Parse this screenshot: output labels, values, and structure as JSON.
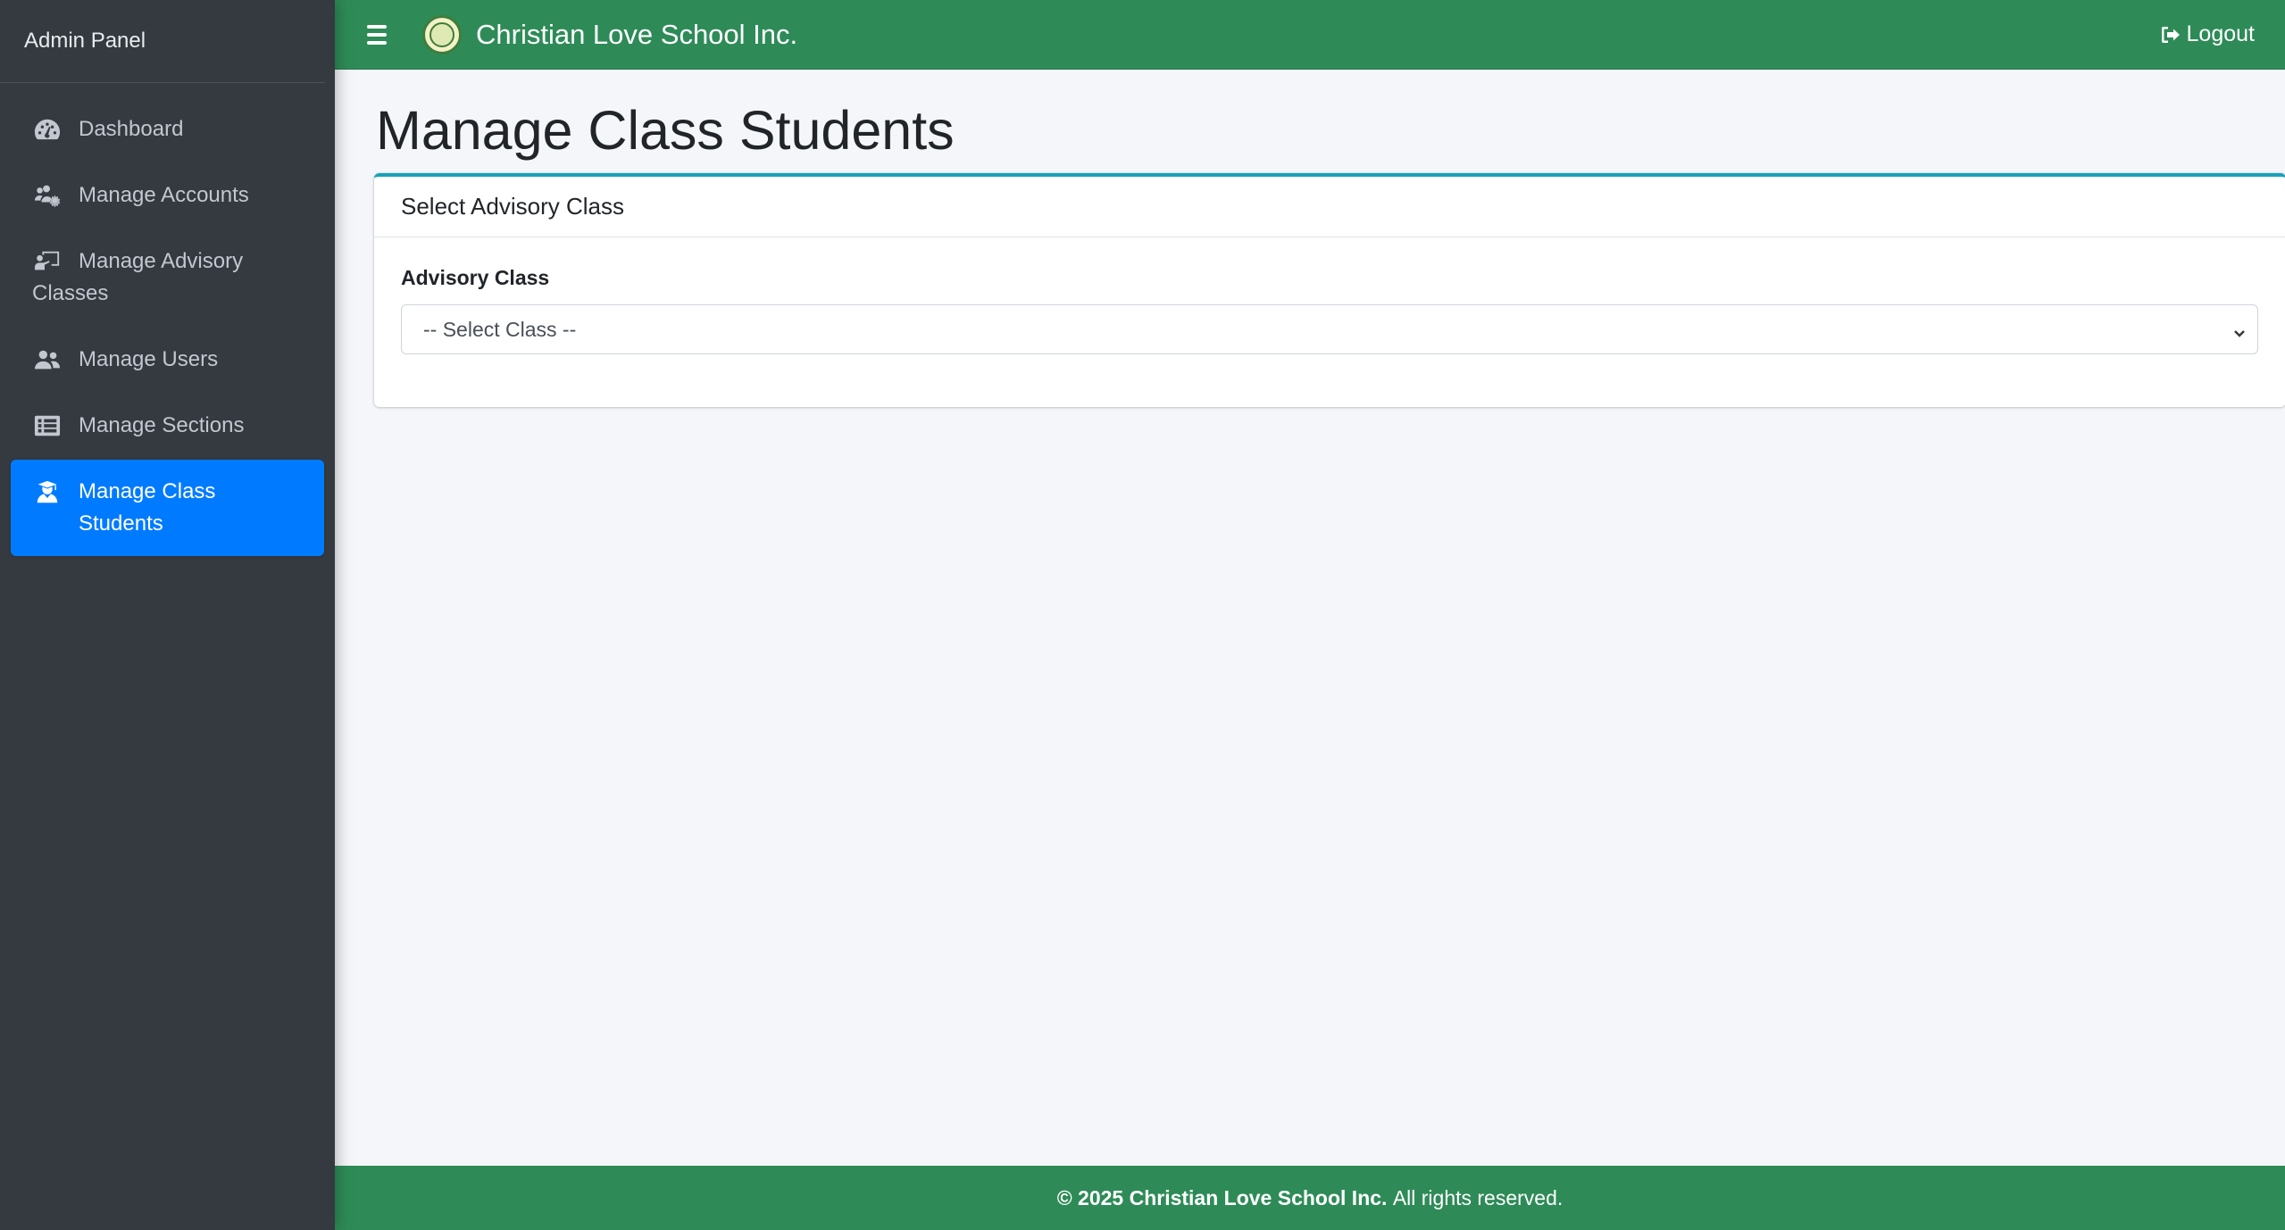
{
  "sidebar": {
    "brand": "Admin Panel",
    "items": [
      {
        "label": "Dashboard",
        "icon": "tachometer-icon"
      },
      {
        "label": "Manage Accounts",
        "icon": "users-cog-icon"
      },
      {
        "label": "Manage Advisory Classes",
        "icon": "chalkboard-teacher-icon"
      },
      {
        "label": "Manage Users",
        "icon": "users-icon"
      },
      {
        "label": "Manage Sections",
        "icon": "list-icon"
      },
      {
        "label": "Manage Class Students",
        "icon": "user-graduate-icon",
        "active": true
      }
    ]
  },
  "topbar": {
    "school_name": "Christian Love School Inc.",
    "logout_label": "Logout",
    "menu_icon": "hamburger-icon",
    "logo_icon": "school-seal-logo"
  },
  "main": {
    "page_title": "Manage Class Students",
    "card_title": "Select Advisory Class",
    "field_label": "Advisory Class",
    "select_value": "-- Select Class --"
  },
  "footer": {
    "copyright": "© 2025 Christian Love School Inc.",
    "rights": "All rights reserved."
  },
  "colors": {
    "sidebar_bg": "#343a40",
    "topbar_bg": "#2e8b57",
    "active_item": "#007bff",
    "card_accent": "#17a2b8",
    "content_bg": "#f4f6f9"
  }
}
